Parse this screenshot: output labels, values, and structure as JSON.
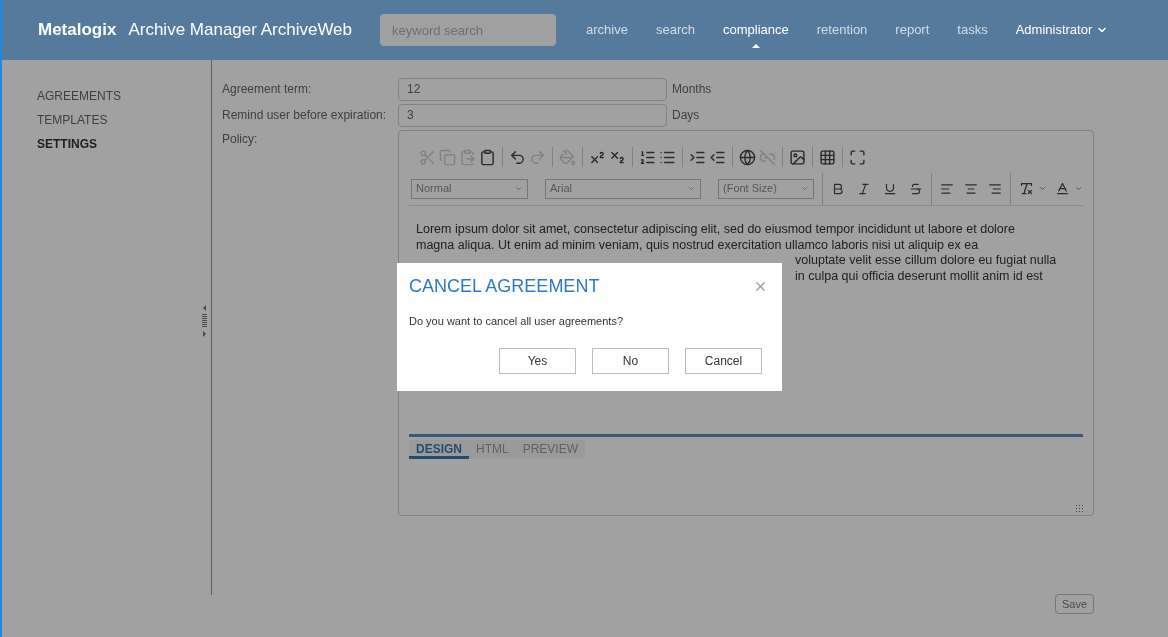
{
  "header": {
    "brand": "Metalogix",
    "title": "Archive Manager ArchiveWeb",
    "search": {
      "placeholder": "keyword search"
    },
    "nav": [
      {
        "label": "archive",
        "selected": false
      },
      {
        "label": "search",
        "selected": false
      },
      {
        "label": "compliance",
        "selected": true
      },
      {
        "label": "retention",
        "selected": false
      },
      {
        "label": "report",
        "selected": false
      },
      {
        "label": "tasks",
        "selected": false
      }
    ],
    "user": "Administrator"
  },
  "sidebar": {
    "items": [
      {
        "label": "AGREEMENTS",
        "selected": false
      },
      {
        "label": "TEMPLATES",
        "selected": false
      },
      {
        "label": "SETTINGS",
        "selected": true
      }
    ]
  },
  "form": {
    "fields": [
      {
        "label": "Agreement term:",
        "value": "12",
        "unit": "Months"
      },
      {
        "label": "Remind user before expiration:",
        "value": "3",
        "unit": "Days"
      }
    ],
    "policy_label": "Policy:"
  },
  "editor": {
    "toolbar_buttons": [
      {
        "disabled": true
      },
      {
        "disabled": true
      },
      {
        "disabled": true
      },
      {
        "disabled": false
      },
      {
        "disabled": false
      },
      {
        "disabled": true
      },
      {
        "disabled": true
      },
      {
        "disabled": false
      },
      {
        "disabled": false
      },
      {
        "disabled": false
      },
      {
        "disabled": false
      },
      {
        "disabled": false
      },
      {
        "disabled": false
      },
      {
        "disabled": false
      },
      {
        "disabled": true
      },
      {
        "disabled": false
      },
      {
        "disabled": false
      },
      {
        "disabled": false
      }
    ],
    "dropdowns": [
      "Normal",
      "Arial",
      "(Font Size)"
    ],
    "content_lines": [
      {
        "text": "Lorem ipsum dolor sit amet, consectetur adipiscing elit, sed do eiusmod tempor incididunt ut labore et dolore",
        "kind": "full"
      },
      {
        "text": "magna aliqua. Ut enim ad minim veniam, quis nostrud exercitation ullamco laboris nisi ut aliquip ex ea",
        "kind": "full"
      },
      {
        "text": "voluptate velit esse cillum dolore eu fugiat nulla",
        "kind": "partial"
      },
      {
        "text": "in culpa qui officia deserunt mollit anim id est",
        "kind": "partial"
      }
    ],
    "tabs": [
      {
        "label": "DESIGN",
        "selected": true
      },
      {
        "label": "HTML",
        "selected": false
      },
      {
        "label": "PREVIEW",
        "selected": false
      }
    ]
  },
  "save_button": "Save",
  "dialog": {
    "title": "CANCEL AGREEMENT",
    "message": "Do you want to cancel all user agreements?",
    "buttons": [
      "Yes",
      "No",
      "Cancel"
    ]
  }
}
